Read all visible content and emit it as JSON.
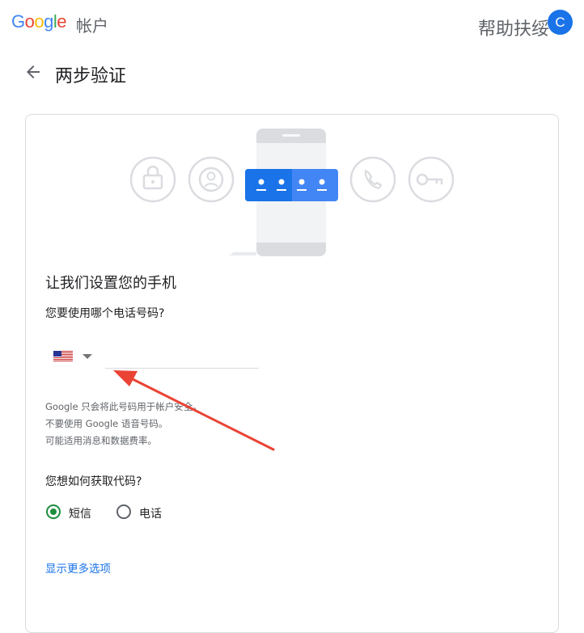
{
  "header": {
    "logo_letters": [
      "G",
      "o",
      "o",
      "g",
      "l",
      "e"
    ],
    "logo_colors": [
      "#4285F4",
      "#EA4335",
      "#FBBC05",
      "#4285F4",
      "#34A853",
      "#EA4335"
    ],
    "product": "帐户",
    "help": "帮助扶绥",
    "avatar_initial": "C"
  },
  "page": {
    "title": "两步验证"
  },
  "illustration": {
    "icons": [
      "lock-icon",
      "person-icon",
      "phone-call-icon",
      "key-icon"
    ],
    "accent": "#4285F4"
  },
  "form": {
    "heading": "让我们设置您的手机",
    "phone_question": "您要使用哪个电话号码?",
    "phone_value": "",
    "country_icon": "us-flag-icon",
    "notes": [
      "Google 只会将此号码用于帐户安全。",
      "不要使用 Google 语音号码。",
      "可能适用消息和数据费率。"
    ],
    "code_question": "您想如何获取代码?",
    "options": [
      {
        "label": "短信",
        "selected": true
      },
      {
        "label": "电话",
        "selected": false
      }
    ],
    "more_options": "显示更多选项"
  },
  "colors": {
    "brand_blue": "#1a73e8",
    "radio_green": "#1e8e3e",
    "annotation_red": "#EA4335"
  }
}
